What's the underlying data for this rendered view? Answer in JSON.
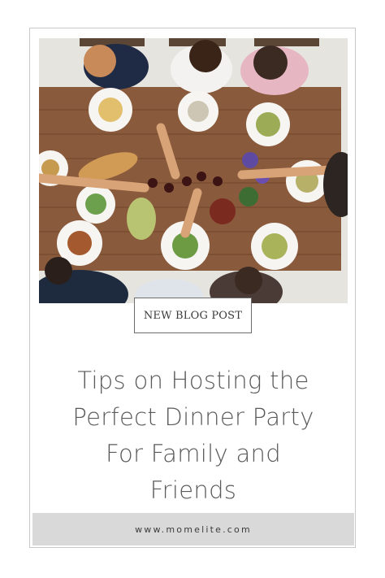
{
  "badge": {
    "label": "NEW BLOG POST"
  },
  "title": {
    "lines": [
      "Tips on Hosting the",
      "Perfect Dinner Party",
      "For Family and",
      "Friends"
    ]
  },
  "footer": {
    "url": "www.momelite.com"
  },
  "photo": {
    "subject": "overhead dinner table with friends toasting"
  },
  "colors": {
    "table": "#8a5a3c",
    "floor": "#e9e7e2",
    "text": "#5a5a5a",
    "footer_bg": "#d9d9d9"
  }
}
